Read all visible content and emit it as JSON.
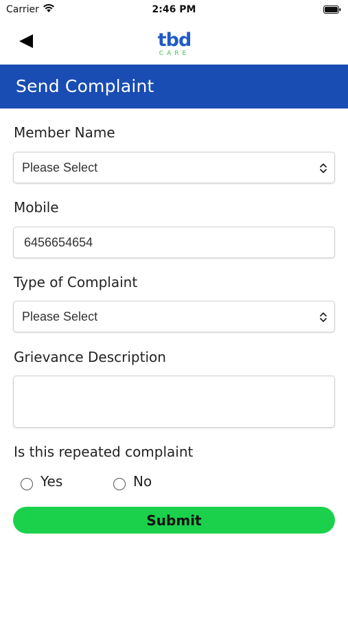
{
  "status_bar": {
    "carrier": "Carrier",
    "time": "2:46 PM"
  },
  "nav": {
    "logo_text": "tbd",
    "logo_sub": "CARE"
  },
  "header": {
    "title": "Send Complaint"
  },
  "form": {
    "member_name_label": "Member Name",
    "member_name_value": "Please Select",
    "mobile_label": "Mobile",
    "mobile_value": "6456654654",
    "type_label": "Type of Complaint",
    "type_value": "Please Select",
    "description_label": "Grievance Description",
    "description_value": "",
    "repeated_label": "Is this repeated complaint",
    "yes_label": "Yes",
    "no_label": "No",
    "submit_label": "Submit"
  },
  "colors": {
    "header_blue": "#1a4db3",
    "submit_green": "#1bd14c",
    "logo_blue": "#1f5cc4",
    "logo_green": "#3cc04a"
  }
}
